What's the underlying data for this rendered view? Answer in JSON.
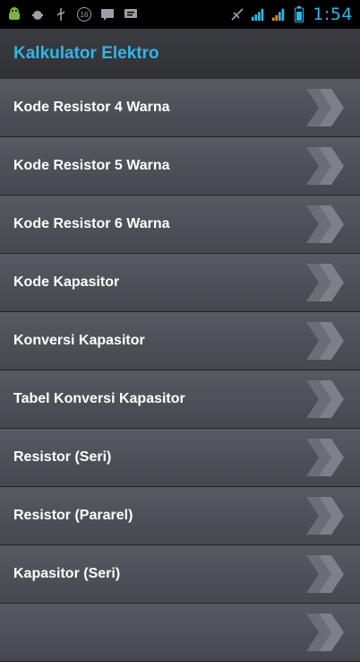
{
  "status_bar": {
    "time": "1:54",
    "left_icons": [
      "android-icon",
      "android-debug-icon",
      "usb-icon",
      "notification-16-icon",
      "message-icon",
      "chat-icon"
    ],
    "right_icons": [
      "no-signal-icon",
      "hsdpa-signal-icon",
      "signal-bars-icon",
      "battery-charging-icon"
    ],
    "badge_text": "16"
  },
  "header": {
    "title": "Kalkulator Elektro"
  },
  "menu": {
    "items": [
      {
        "label": "Kode Resistor 4 Warna"
      },
      {
        "label": "Kode Resistor 5 Warna"
      },
      {
        "label": "Kode Resistor 6 Warna"
      },
      {
        "label": "Kode Kapasitor"
      },
      {
        "label": "Konversi Kapasitor"
      },
      {
        "label": "Tabel Konversi Kapasitor"
      },
      {
        "label": "Resistor (Seri)"
      },
      {
        "label": "Resistor (Pararel)"
      },
      {
        "label": "Kapasitor (Seri)"
      },
      {
        "label": ""
      }
    ]
  },
  "colors": {
    "accent": "#33b5e5",
    "item_bg": "#505359",
    "text": "#ffffff"
  }
}
